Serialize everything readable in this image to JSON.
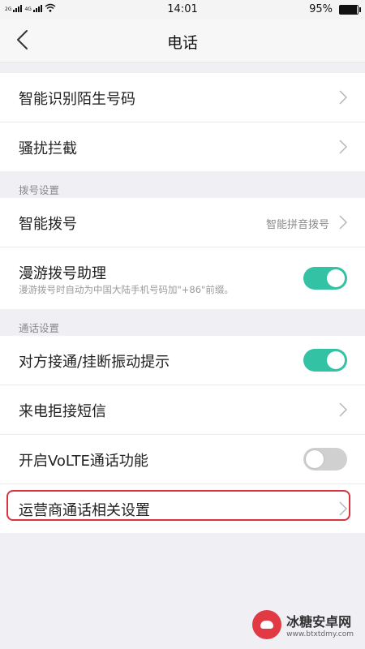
{
  "status": {
    "network_top": "2G",
    "network_bottom": "4G",
    "time": "14:01",
    "battery": "95%",
    "battery_level": 0.95
  },
  "header": {
    "title": "电话"
  },
  "group1": {
    "items": [
      {
        "label": "智能识别陌生号码"
      },
      {
        "label": "骚扰拦截"
      }
    ]
  },
  "dial_section": {
    "header": "拨号设置",
    "smart_dial": {
      "label": "智能拨号",
      "value": "智能拼音拨号"
    },
    "roaming": {
      "label": "漫游拨号助理",
      "desc": "漫游拨号时自动为中国大陆手机号码加\"+86\"前缀。",
      "enabled": true
    }
  },
  "call_section": {
    "header": "通话设置",
    "vibration": {
      "label": "对方接通/挂断振动提示",
      "enabled": true
    },
    "reject_sms": {
      "label": "来电拒接短信"
    },
    "volte": {
      "label": "开启VoLTE通话功能",
      "enabled": false
    },
    "carrier": {
      "label": "运营商通话相关设置"
    }
  },
  "colors": {
    "accent": "#33c2a3",
    "highlight": "#d8343f"
  },
  "watermark": {
    "main": "冰糖安卓网",
    "url": "www.btxtdmy.com"
  }
}
